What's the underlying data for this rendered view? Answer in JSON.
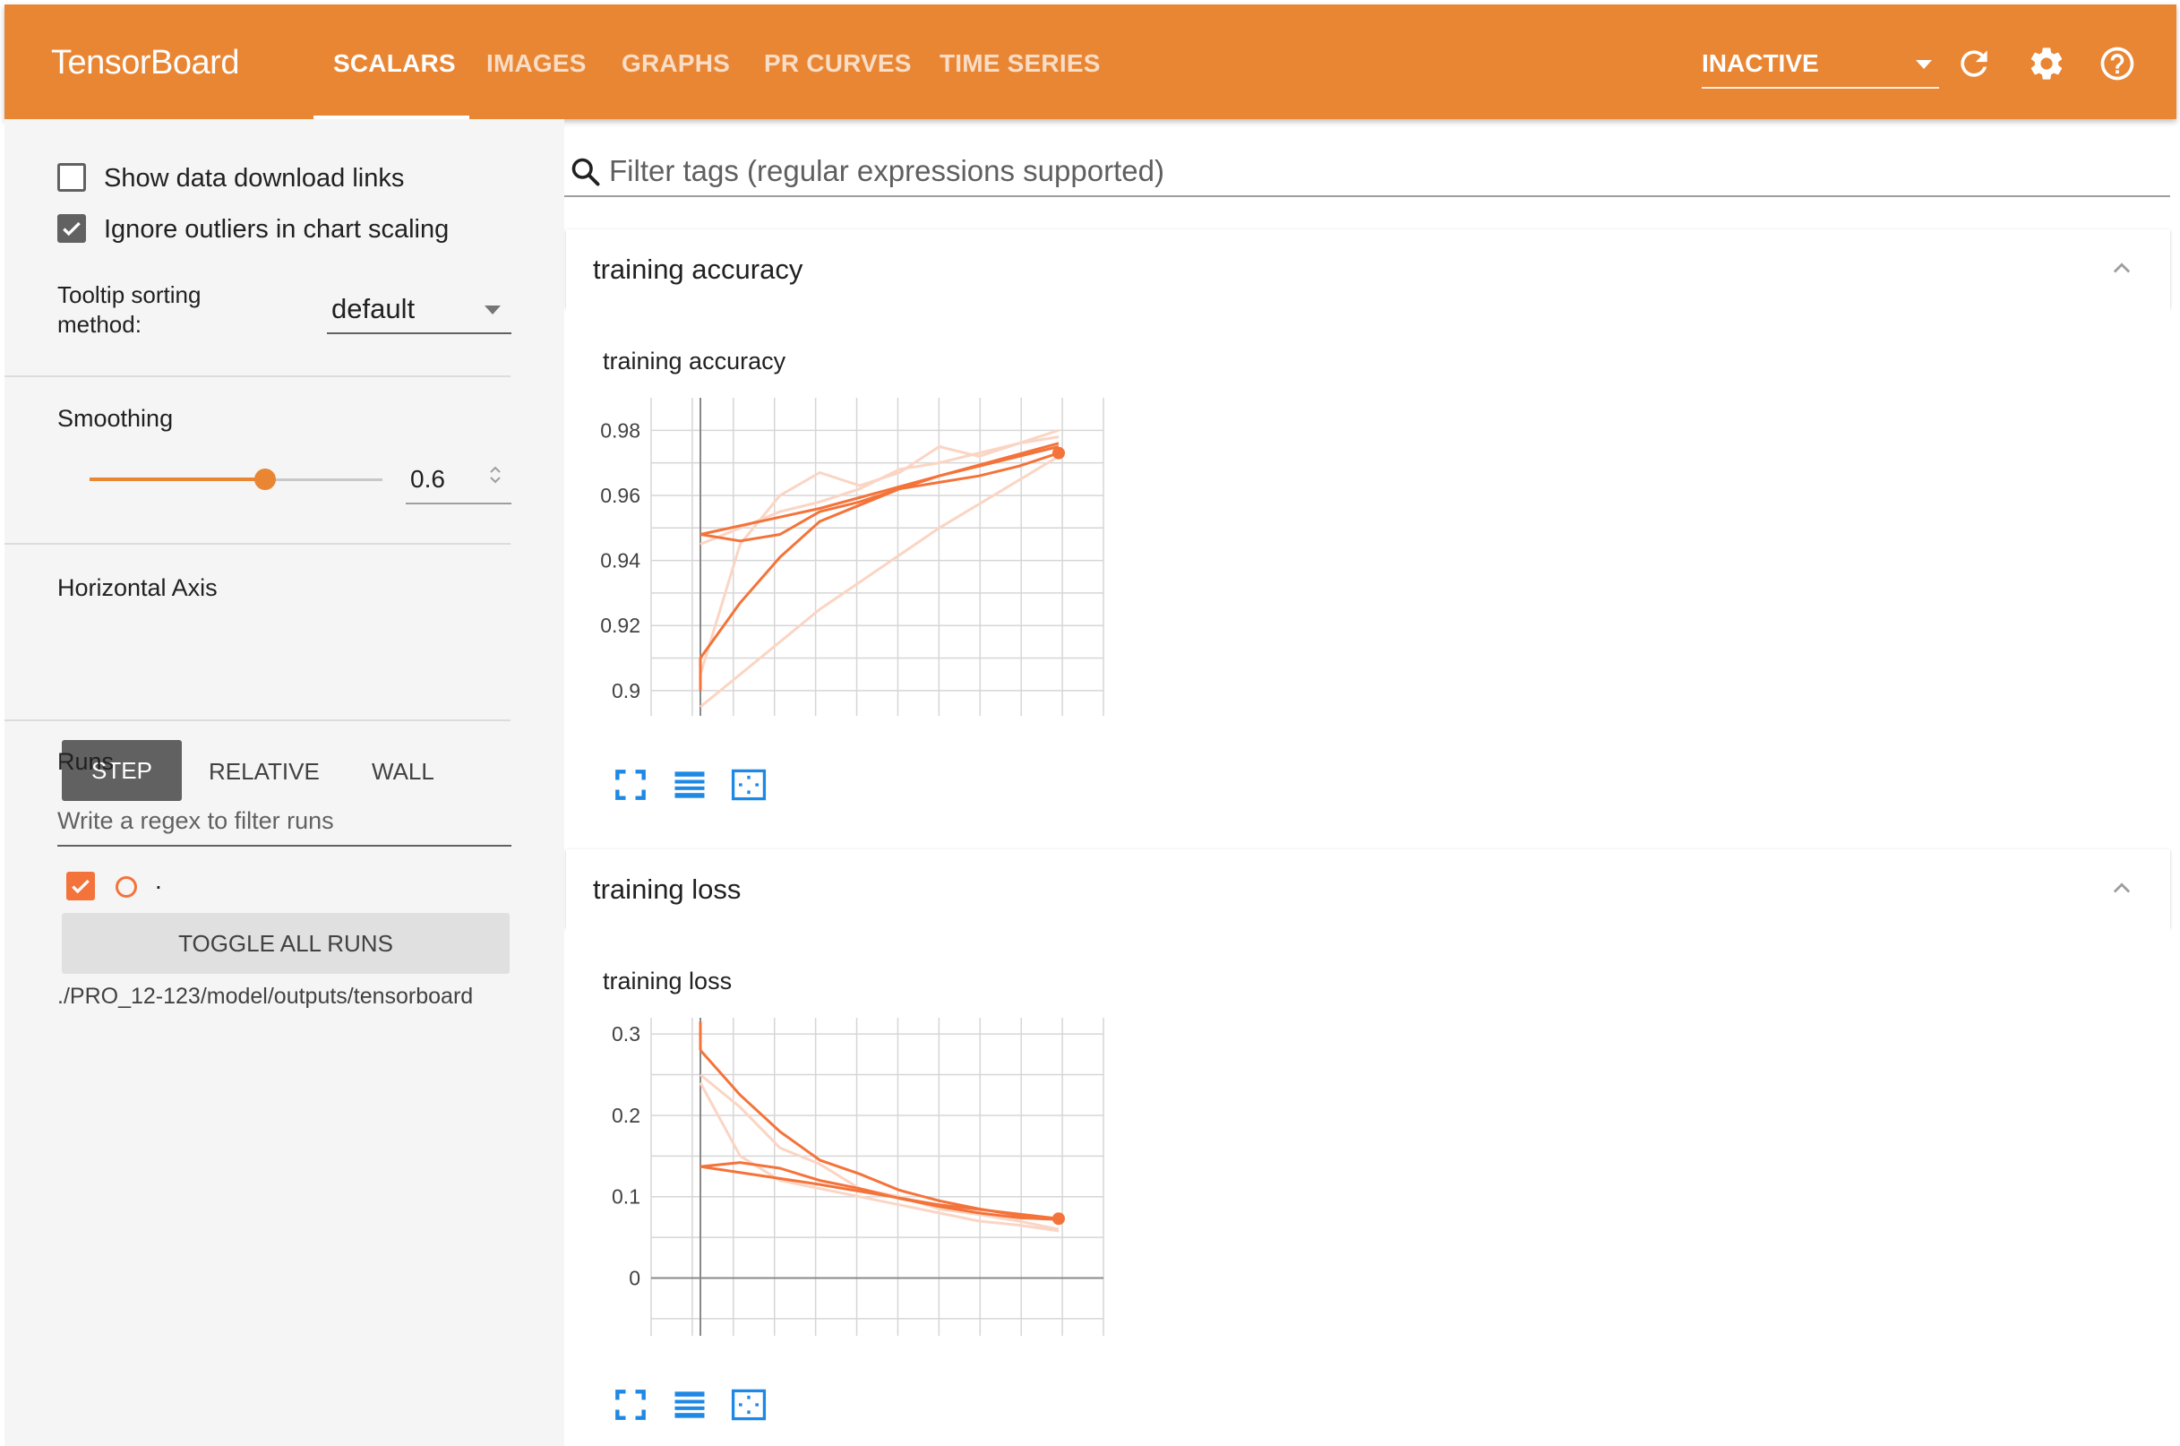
{
  "header": {
    "brand": "TensorBoard",
    "tabs": [
      "SCALARS",
      "IMAGES",
      "GRAPHS",
      "PR CURVES",
      "TIME SERIES"
    ],
    "active_tab": "SCALARS",
    "status_select": "INACTIVE",
    "icons": [
      "refresh-icon",
      "settings-icon",
      "help-icon"
    ]
  },
  "sidebar": {
    "show_download_links": {
      "label": "Show data download links",
      "checked": false
    },
    "ignore_outliers": {
      "label": "Ignore outliers in chart scaling",
      "checked": true
    },
    "tooltip_sorting": {
      "label_line1": "Tooltip sorting",
      "label_line2": "method:",
      "value": "default"
    },
    "smoothing": {
      "label": "Smoothing",
      "value": "0.6",
      "slider_fraction": 0.6
    },
    "horizontal_axis": {
      "label": "Horizontal Axis",
      "options": [
        "STEP",
        "RELATIVE",
        "WALL"
      ],
      "selected": "STEP"
    },
    "runs": {
      "label": "Runs",
      "filter_placeholder": "Write a regex to filter runs",
      "run_name": ".",
      "run_checked": true,
      "toggle_label": "TOGGLE ALL RUNS",
      "logdir": "./PRO_12-123/model/outputs/tensorboard"
    }
  },
  "main": {
    "filter_placeholder": "Filter tags (regular expressions supported)",
    "cards": [
      {
        "title": "training accuracy",
        "chart_title": "training accuracy"
      },
      {
        "title": "training loss",
        "chart_title": "training loss"
      }
    ]
  },
  "colors": {
    "brand": "#e98634",
    "series": "#f4733a",
    "series_raw": "#fbd5c4"
  },
  "chart_data": [
    {
      "type": "line",
      "title": "training accuracy",
      "ylim": [
        0.895,
        0.99
      ],
      "yticks": [
        0.9,
        0.92,
        0.94,
        0.96,
        0.98
      ],
      "ytick_labels": [
        "0.9",
        "0.92",
        "0.94",
        "0.96",
        "0.98"
      ],
      "grid": true,
      "series": [
        {
          "values": [
            [
              0,
              0.948
            ],
            [
              1,
              0.946
            ],
            [
              2,
              0.948
            ],
            [
              3,
              0.955
            ],
            [
              4,
              0.958
            ],
            [
              5,
              0.962
            ],
            [
              6,
              0.966
            ],
            [
              7,
              0.969
            ],
            [
              8,
              0.972
            ],
            [
              9,
              0.975
            ]
          ]
        },
        {
          "values": [
            [
              0,
              0.948
            ],
            [
              3,
              0.956
            ],
            [
              6,
              0.966
            ],
            [
              9,
              0.976
            ]
          ]
        },
        {
          "values": [
            [
              0,
              0.91
            ],
            [
              1,
              0.927
            ],
            [
              2,
              0.941
            ],
            [
              3,
              0.952
            ],
            [
              4,
              0.957
            ],
            [
              5,
              0.962
            ],
            [
              6,
              0.964
            ],
            [
              7,
              0.966
            ],
            [
              8,
              0.969
            ],
            [
              9,
              0.973
            ]
          ]
        },
        {
          "values": [
            [
              0,
              0.9
            ],
            [
              0,
              0.91
            ]
          ]
        }
      ],
      "raw_series": [
        {
          "values": [
            [
              0,
              0.905
            ],
            [
              1,
              0.945
            ],
            [
              2,
              0.96
            ],
            [
              3,
              0.967
            ],
            [
              4,
              0.963
            ],
            [
              5,
              0.967
            ],
            [
              6,
              0.975
            ],
            [
              7,
              0.972
            ],
            [
              8,
              0.976
            ],
            [
              9,
              0.98
            ]
          ]
        },
        {
          "values": [
            [
              0,
              0.945
            ],
            [
              1,
              0.95
            ],
            [
              2,
              0.955
            ],
            [
              3,
              0.958
            ],
            [
              4,
              0.962
            ],
            [
              5,
              0.968
            ],
            [
              6,
              0.97
            ],
            [
              7,
              0.973
            ],
            [
              8,
              0.976
            ],
            [
              9,
              0.978
            ]
          ]
        },
        {
          "values": [
            [
              0,
              0.895
            ],
            [
              3,
              0.925
            ],
            [
              6,
              0.95
            ],
            [
              9,
              0.972
            ]
          ]
        }
      ],
      "end_marker": [
        9,
        0.973
      ]
    },
    {
      "type": "line",
      "title": "training loss",
      "ylim": [
        -0.06,
        0.32
      ],
      "yticks": [
        0,
        0.1,
        0.2,
        0.3
      ],
      "ytick_labels": [
        "0",
        "0.1",
        "0.2",
        "0.3"
      ],
      "grid": true,
      "series": [
        {
          "values": [
            [
              0,
              0.137
            ],
            [
              1,
              0.142
            ],
            [
              2,
              0.135
            ],
            [
              3,
              0.12
            ],
            [
              4,
              0.11
            ],
            [
              5,
              0.098
            ],
            [
              6,
              0.088
            ],
            [
              7,
              0.08
            ],
            [
              8,
              0.074
            ],
            [
              9,
              0.072
            ]
          ]
        },
        {
          "values": [
            [
              0,
              0.137
            ],
            [
              3,
              0.115
            ],
            [
              6,
              0.09
            ],
            [
              9,
              0.073
            ]
          ]
        },
        {
          "values": [
            [
              0,
              0.28
            ],
            [
              1,
              0.225
            ],
            [
              2,
              0.18
            ],
            [
              3,
              0.145
            ],
            [
              4,
              0.128
            ],
            [
              5,
              0.108
            ],
            [
              6,
              0.095
            ],
            [
              7,
              0.085
            ],
            [
              8,
              0.077
            ],
            [
              9,
              0.073
            ]
          ]
        },
        {
          "values": [
            [
              0,
              0.315
            ],
            [
              0,
              0.28
            ]
          ]
        }
      ],
      "raw_series": [
        {
          "values": [
            [
              0,
              0.25
            ],
            [
              1,
              0.21
            ],
            [
              2,
              0.16
            ],
            [
              3,
              0.14
            ],
            [
              4,
              0.11
            ],
            [
              5,
              0.1
            ],
            [
              6,
              0.085
            ],
            [
              7,
              0.078
            ],
            [
              8,
              0.07
            ],
            [
              9,
              0.06
            ]
          ]
        },
        {
          "values": [
            [
              0,
              0.24
            ],
            [
              1,
              0.15
            ],
            [
              2,
              0.12
            ],
            [
              3,
              0.11
            ],
            [
              4,
              0.1
            ],
            [
              5,
              0.09
            ],
            [
              6,
              0.08
            ],
            [
              7,
              0.07
            ],
            [
              8,
              0.065
            ],
            [
              9,
              0.058
            ]
          ]
        }
      ],
      "end_marker": [
        9,
        0.073
      ]
    }
  ]
}
